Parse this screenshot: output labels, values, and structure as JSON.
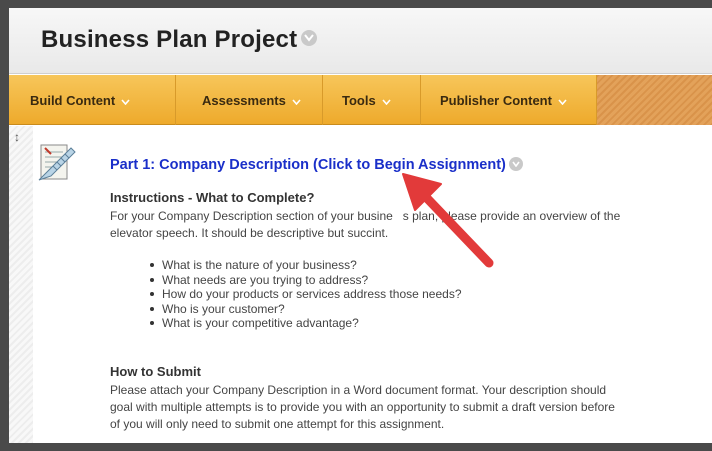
{
  "header": {
    "title": "Business Plan Project"
  },
  "toolbar": {
    "items": [
      "Build Content",
      "Assessments",
      "Tools",
      "Publisher Content"
    ]
  },
  "item": {
    "title": "Part 1: Company Description (Click to Begin Assignment)",
    "instructions_heading": "Instructions - What to Complete?",
    "instructions_line1": "For your Company Description section of your busine   s plan, please provide an overview of the",
    "instructions_line2": "elevator speech. It should be descriptive but succint.",
    "bullets": [
      "What is the nature of your business?",
      "What needs are you trying to address?",
      "How do your products or services address those needs?",
      "Who is your customer?",
      "What is your competitive advantage?"
    ],
    "submit_heading": "How to Submit",
    "submit_line1": "Please attach your Company Description in a Word document format. Your description should",
    "submit_line2": "goal with multiple attempts is to provide you with an opportunity to submit a draft version before",
    "submit_line3": "of you will only need to submit one attempt for this assignment."
  },
  "colors": {
    "toolbar": "#eeaa2c",
    "link": "#1a2fc9",
    "arrow": "#e23a3a"
  }
}
